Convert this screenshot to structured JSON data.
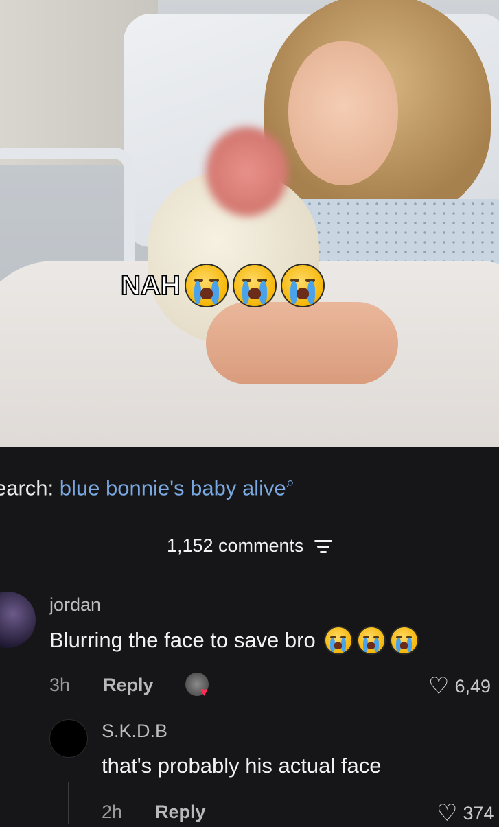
{
  "overlay": {
    "caption": "NAH",
    "emoji_count": 3,
    "emoji": "loudly-crying-face"
  },
  "search": {
    "prefix": "earch:",
    "term": "blue bonnie's baby alive",
    "icon": "search-icon"
  },
  "comments_header": {
    "count_label": "1,152 comments",
    "filter_icon": "filter-icon"
  },
  "comments": [
    {
      "username": "jordan",
      "text": "Blurring the face to save bro",
      "emoji": "loudly-crying-face",
      "emoji_count": 3,
      "time": "3h",
      "reply_label": "Reply",
      "likes": "6,49"
    },
    {
      "username": "S.K.D.B",
      "text": "that's probably his actual face",
      "time": "2h",
      "reply_label": "Reply",
      "likes": "374"
    }
  ],
  "colors": {
    "background": "#161618",
    "link": "#7aa8e0",
    "like_heart_badge": "#ff2d55"
  }
}
